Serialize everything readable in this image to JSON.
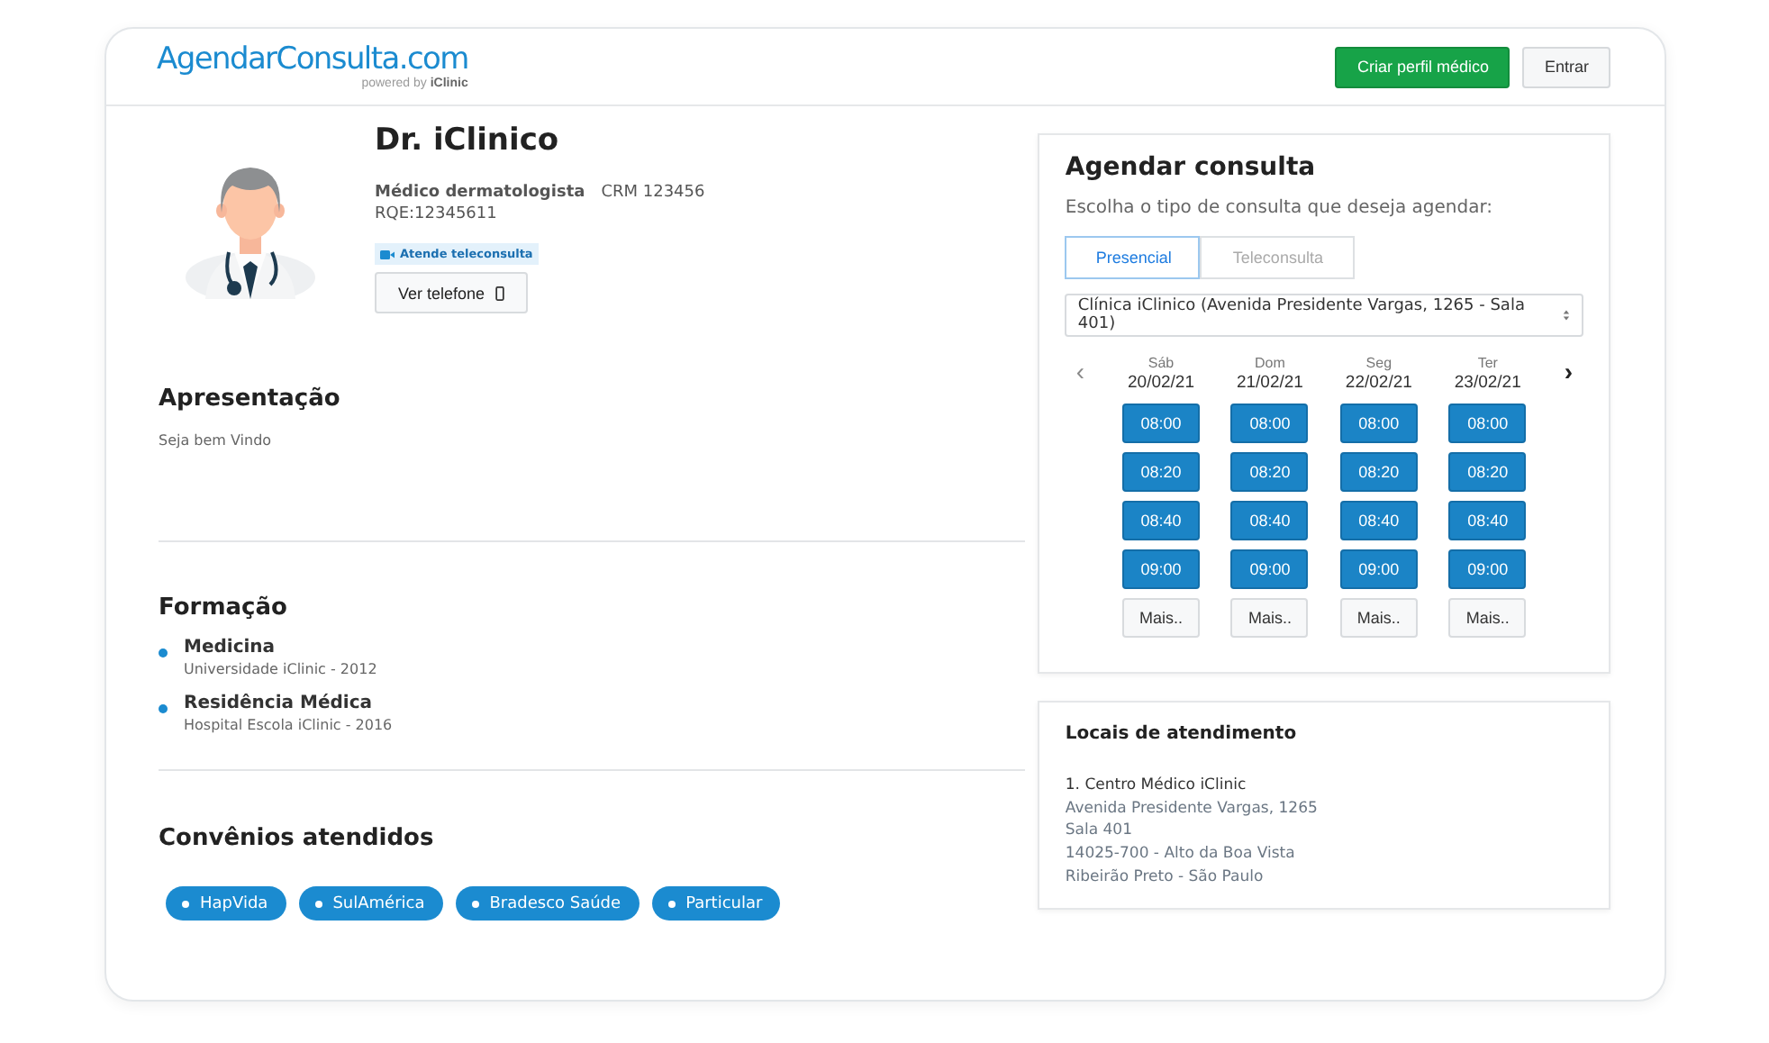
{
  "header": {
    "logo": "**AgendarConsulta**.com",
    "powered_by": "powered by **iClinic**",
    "buttons": [
      {
        "label": "Criar perfil médico",
        "kind": "primary"
      },
      {
        "label": "Entrar",
        "kind": "secondary"
      }
    ]
  },
  "profile": {
    "name": "Dr. iClinico",
    "specialty": "Médico dermatologista",
    "crm": "CRM 123456",
    "rqe": "RQE:12345611",
    "badge": "Atende teleconsulta",
    "phone_button": "Ver telefone"
  },
  "presentation": {
    "title": "Apresentação",
    "text": "Seja bem Vindo"
  },
  "education": {
    "title": "Formação",
    "items": [
      {
        "course": "Medicina",
        "institution": "Universidade iClinic - 2012"
      },
      {
        "course": "Residência Médica",
        "institution": "Hospital Escola iClinic - 2016"
      }
    ]
  },
  "insurances": {
    "title": "Convênios atendidos",
    "items": [
      "HapVida",
      "SulAmérica",
      "Bradesco Saúde",
      "Particular"
    ]
  },
  "booking": {
    "title": "Agendar consulta",
    "prompt": "Escolha o tipo de consulta que deseja agendar:",
    "tabs": [
      {
        "label": "Presencial",
        "selected": true
      },
      {
        "label": "Teleconsulta",
        "selected": false
      }
    ],
    "location_select": "Clínica iClinico (Avenida Presidente Vargas, 1265 - Sala 401)",
    "prev": "‹",
    "next": "›",
    "days": [
      {
        "weekday": "Sáb",
        "date": "20/02/21",
        "times": [
          "08:00",
          "08:20",
          "08:40",
          "09:00"
        ],
        "more": "Mais.."
      },
      {
        "weekday": "Dom",
        "date": "21/02/21",
        "times": [
          "08:00",
          "08:20",
          "08:40",
          "09:00"
        ],
        "more": "Mais.."
      },
      {
        "weekday": "Seg",
        "date": "22/02/21",
        "times": [
          "08:00",
          "08:20",
          "08:40",
          "09:00"
        ],
        "more": "Mais.."
      },
      {
        "weekday": "Ter",
        "date": "23/02/21",
        "times": [
          "08:00",
          "08:20",
          "08:40",
          "09:00"
        ],
        "more": "Mais.."
      }
    ]
  },
  "locations": {
    "title": "Locais de atendimento",
    "items": [
      {
        "name": "1. Centro Médico iClinic",
        "lines": [
          "Avenida Presidente Vargas, 1265",
          "Sala 401",
          "14025-700 - Alto da Boa Vista",
          "Ribeirão Preto - São Paulo"
        ]
      }
    ]
  }
}
